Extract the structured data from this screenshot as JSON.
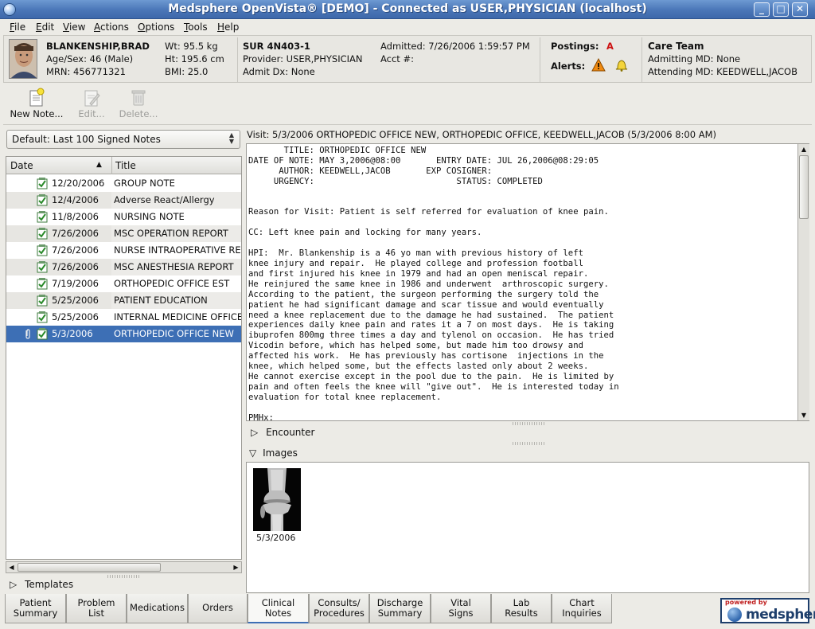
{
  "window": {
    "title": "Medsphere OpenVista® [DEMO] - Connected as USER,PHYSICIAN (localhost)",
    "minimize": "_",
    "maximize": "□",
    "close": "✕"
  },
  "menu": [
    "File",
    "Edit",
    "View",
    "Actions",
    "Options",
    "Tools",
    "Help"
  ],
  "patient": {
    "name": "BLANKENSHIP,BRAD",
    "age_sex": "Age/Sex: 46 (Male)",
    "mrn": "MRN: 456771321",
    "wt": "Wt: 95.5 kg",
    "ht": "Ht: 195.6 cm",
    "bmi": "BMI: 25.0",
    "location": "SUR 4N403-1",
    "provider": "Provider: USER,PHYSICIAN",
    "admit_dx": "Admit Dx: None",
    "admitted": "Admitted: 7/26/2006 1:59:57 PM",
    "acct": "Acct #:",
    "postings_label": "Postings:",
    "postings_value": "A",
    "alerts_label": "Alerts:",
    "care_team_label": "Care Team",
    "admitting_md": "Admitting MD: None",
    "attending_md": "Attending MD: KEEDWELL,JACOB"
  },
  "toolbar": {
    "new_note": "New Note...",
    "edit": "Edit...",
    "delete": "Delete..."
  },
  "filter": {
    "selected": "Default: Last 100 Signed Notes"
  },
  "notes_list": {
    "col_date": "Date",
    "col_title": "Title",
    "rows": [
      {
        "date": "12/20/2006",
        "title": "GROUP NOTE"
      },
      {
        "date": "12/4/2006",
        "title": "Adverse React/Allergy"
      },
      {
        "date": "11/8/2006",
        "title": "NURSING NOTE"
      },
      {
        "date": "7/26/2006",
        "title": "MSC OPERATION REPORT"
      },
      {
        "date": "7/26/2006",
        "title": "NURSE INTRAOPERATIVE REPORT"
      },
      {
        "date": "7/26/2006",
        "title": "MSC ANESTHESIA REPORT"
      },
      {
        "date": "7/19/2006",
        "title": "ORTHOPEDIC OFFICE EST"
      },
      {
        "date": "5/25/2006",
        "title": "PATIENT EDUCATION"
      },
      {
        "date": "5/25/2006",
        "title": "INTERNAL MEDICINE OFFICE NOTE"
      },
      {
        "date": "5/3/2006",
        "title": "ORTHOPEDIC OFFICE NEW"
      }
    ],
    "selected_index": 9
  },
  "templates_label": "Templates",
  "visit_line": "Visit: 5/3/2006 ORTHOPEDIC OFFICE NEW, ORTHOPEDIC OFFICE, KEEDWELL,JACOB (5/3/2006 8:00 AM)",
  "note_text": "       TITLE: ORTHOPEDIC OFFICE NEW\nDATE OF NOTE: MAY 3,2006@08:00       ENTRY DATE: JUL 26,2006@08:29:05\n      AUTHOR: KEEDWELL,JACOB       EXP COSIGNER:\n     URGENCY:                            STATUS: COMPLETED\n\n\nReason for Visit: Patient is self referred for evaluation of knee pain.\n\nCC: Left knee pain and locking for many years.\n\nHPI:  Mr. Blankenship is a 46 yo man with previous history of left\nknee injury and repair.  He played college and profession football\nand first injured his knee in 1979 and had an open meniscal repair.\nHe reinjured the same knee in 1986 and underwent  arthroscopic surgery.\nAccording to the patient, the surgeon performing the surgery told the\npatient he had significant damage and scar tissue and would eventually\nneed a knee replacement due to the damage he had sustained.  The patient\nexperiences daily knee pain and rates it a 7 on most days.  He is taking\nibuprofen 800mg three times a day and tylenol on occasion.  He has tried\nVicodin before, which has helped some, but made him too drowsy and\naffected his work.  He has previously has cortisone  injections in the\nknee, which helped some, but the effects lasted only about 2 weeks.\nHe cannot exercise except in the pool due to the pain.  He is limited by\npain and often feels the knee will \"give out\".  He is interested today in\nevaluation for total knee replacement.\n\nPMHx:",
  "encounter_label": "Encounter",
  "images_label": "Images",
  "image_caption": "5/3/2006",
  "tabs": [
    {
      "label": "Patient\nSummary"
    },
    {
      "label": "Problem\nList"
    },
    {
      "label": "Medications"
    },
    {
      "label": "Orders"
    },
    {
      "label": "Clinical\nNotes"
    },
    {
      "label": "Consults/\nProcedures"
    },
    {
      "label": "Discharge\nSummary"
    },
    {
      "label": "Vital\nSigns"
    },
    {
      "label": "Lab\nResults"
    },
    {
      "label": "Chart\nInquiries"
    }
  ],
  "active_tab": 4,
  "logo": {
    "powered_by": "powered by",
    "name": "medsphere"
  },
  "colors": {
    "selection": "#3d6fb5",
    "postings_flag": "#cc1010",
    "titlebar": "#4a76b7"
  }
}
